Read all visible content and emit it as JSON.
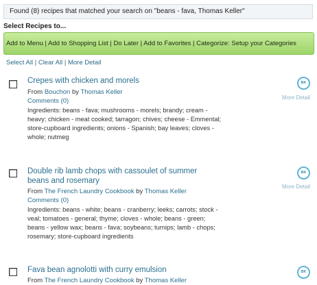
{
  "banner": {
    "text": "Found (8) recipes that matched your search on \"beans - fava, Thomas Keller\""
  },
  "select_heading": "Select Recipes to...",
  "action_bar": {
    "items": [
      "Add to Menu",
      "Add to Shopping List",
      "Do Later",
      "Add to Favorites",
      "Categorize: Setup your Categories"
    ],
    "separator": " | "
  },
  "selection_links": {
    "select_all": "Select All",
    "clear_all": "Clear All",
    "more_detail": "More Detail",
    "separator": " | "
  },
  "recipes": [
    {
      "title": "Crepes with chicken and morels",
      "from_label": "From ",
      "source": "Bouchon",
      "by_label": " by ",
      "author": "Thomas Keller",
      "comments": "Comments (0)",
      "ingredients": "Ingredients:   beans - fava; mushrooms - morels; brandy; cream - heavy; chicken - meat cooked; tarragon; chives; cheese - Emmental; store-cupboard ingredients; onions - Spanish; bay leaves; cloves - whole; nutmeg",
      "badge": "BK",
      "more_detail": "More Detail"
    },
    {
      "title": "Double rib lamb chops with cassoulet of summer beans and rosemary",
      "from_label": "From ",
      "source": "The French Laundry Cookbook",
      "by_label": " by ",
      "author": "Thomas Keller",
      "comments": "Comments (0)",
      "ingredients": "Ingredients:   beans - white; beans - cranberry; leeks; carrots; stock - veal; tomatoes - general; thyme; cloves - whole; beans - green; beans - yellow wax; beans - fava; soybeans; turnips; lamb - chops; rosemary; store-cupboard ingredients",
      "badge": "BK",
      "more_detail": "More Detail"
    },
    {
      "title": "Fava bean agnolotti with curry emulsion",
      "from_label": "From ",
      "source": "The French Laundry Cookbook",
      "by_label": " by ",
      "author": "Thomas Keller",
      "badge": "BK"
    }
  ]
}
